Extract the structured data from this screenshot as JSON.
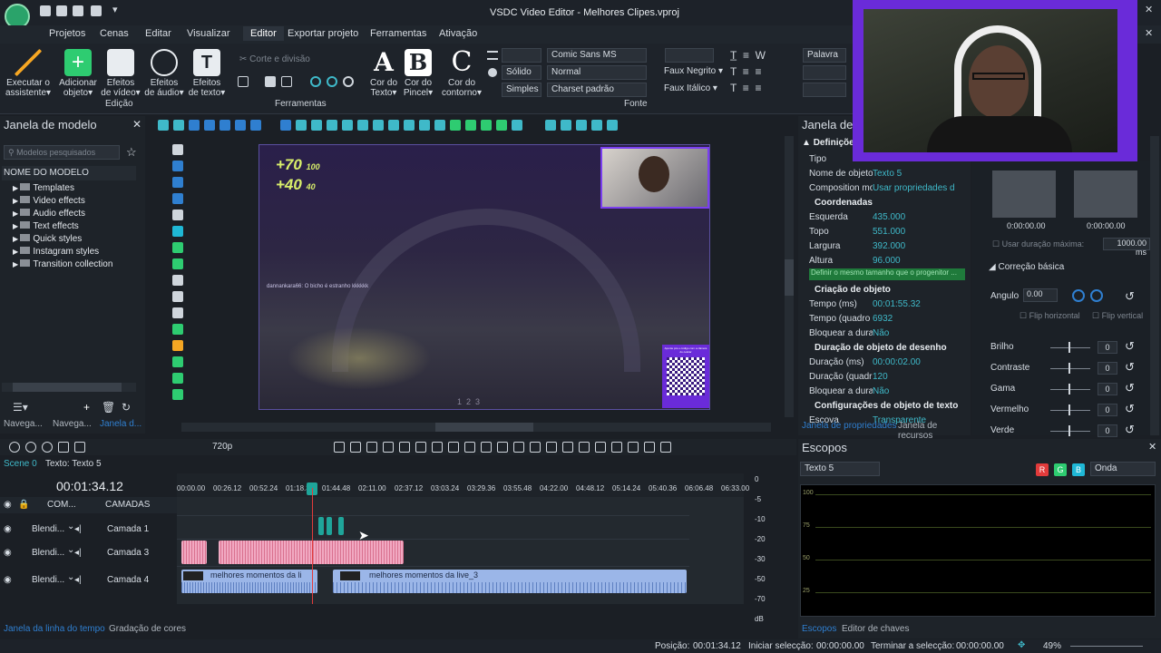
{
  "window": {
    "title": "VSDC Video Editor - Melhores Clipes.vproj"
  },
  "menu": [
    "Projetos",
    "Cenas",
    "Editar",
    "Visualizar",
    "Editor",
    "Exportar projeto",
    "Ferramentas",
    "Ativação"
  ],
  "menu_active_index": 4,
  "ribbon": {
    "buttons": [
      {
        "l1": "Executar o",
        "l2": "assistente▾"
      },
      {
        "l1": "Adicionar",
        "l2": "objeto▾"
      },
      {
        "l1": "Efeitos",
        "l2": "de vídeo▾"
      },
      {
        "l1": "Efeitos",
        "l2": "de áudio▾"
      },
      {
        "l1": "Efeitos",
        "l2": "de texto▾"
      }
    ],
    "group_edicao": "Edição",
    "cut_label": "Corte e divisão",
    "group_ferramentas": "Ferramentas",
    "font_buttons": [
      {
        "l1": "Cor do",
        "l2": "Texto▾"
      },
      {
        "l1": "Cor do",
        "l2": "Pincel▾"
      },
      {
        "l1": "Cor do",
        "l2": "contorno▾"
      }
    ],
    "solid": "Sólido",
    "simple": "Simples",
    "font_family": "Comic Sans MS",
    "font_style": "Normal",
    "charset": "Charset padrão",
    "faux_bold": "Faux Negrito",
    "faux_italic": "Faux Itálico",
    "group_fonte": "Fonte",
    "word_wrap": "Palavra"
  },
  "template_panel": {
    "title": "Janela de modelo",
    "search_placeholder": "Modelos pesquisados",
    "column": "NOME DO MODELO",
    "items": [
      "Templates",
      "Video effects",
      "Audio effects",
      "Text effects",
      "Quick styles",
      "Instagram styles",
      "Transition collection"
    ],
    "tabs": [
      "Navega...",
      "Navega...",
      "Janela d..."
    ]
  },
  "preview": {
    "hud1": "+70",
    "hud1_small": "100",
    "hud2": "+40",
    "hud2_small": "40",
    "chat": "dannankara66: O bicho é estranho kkkkkk",
    "pager": "1  2  3",
    "qr_caption": "Aponte pra o código com a câmera do celular"
  },
  "properties": {
    "title": "Janela de",
    "header": "Definições",
    "rows": [
      {
        "k": "Tipo",
        "v": ""
      },
      {
        "k": "Nome de objeto",
        "v": "Texto 5"
      },
      {
        "k": "Composition mod",
        "v": "Usar propriedades da"
      }
    ],
    "coords_title": "Coordenadas",
    "coords": [
      {
        "k": "Esquerda",
        "v": "435.000"
      },
      {
        "k": "Topo",
        "v": "551.000"
      },
      {
        "k": "Largura",
        "v": "392.000"
      },
      {
        "k": "Altura",
        "v": "96.000"
      }
    ],
    "parent_btn": "Definir o mesmo tamanho que o progenitor ...",
    "creation_title": "Criação de objeto",
    "creation": [
      {
        "k": "Tempo (ms)",
        "v": "00:01:55.32"
      },
      {
        "k": "Tempo (quadro",
        "v": "6932"
      },
      {
        "k": "Bloquear a dura",
        "v": "Não"
      }
    ],
    "duration_title": "Duração de objeto de desenho",
    "duration": [
      {
        "k": "Duração (ms)",
        "v": "00:00:02.00"
      },
      {
        "k": "Duração (quadr",
        "v": "120"
      },
      {
        "k": "Bloquear a dura",
        "v": "Não"
      }
    ],
    "text_cfg_title": "Configurações de objeto de texto",
    "text_cfg": [
      {
        "k": "Escova",
        "v": "Transparente"
      }
    ],
    "tabs": [
      "Janela de propriedades",
      "Janela de recursos"
    ]
  },
  "basic_correction": {
    "t1": "0:00:00.00",
    "t2": "0:00:00.00",
    "max_duration_label": "Usar duração máxima:",
    "max_duration_value": "1000.00 ms",
    "title": "Correção básica",
    "angle_label": "Angulo",
    "angle_value": "0.00",
    "flip_h": "Flip horizontal",
    "flip_v": "Flip vertical",
    "sliders": [
      {
        "k": "Brilho",
        "v": "0"
      },
      {
        "k": "Contraste",
        "v": "0"
      },
      {
        "k": "Gama",
        "v": "0"
      },
      {
        "k": "Vermelho",
        "v": "0"
      },
      {
        "k": "Verde",
        "v": "0"
      }
    ]
  },
  "timeline": {
    "quality": "720p",
    "scene_tab": "Scene 0",
    "text_tab": "Texto: Texto 5",
    "timecode": "00:01:34.12",
    "ruler": [
      "00:00.00",
      "00:26.12",
      "00:52.24",
      "01:18.36",
      "01:44.48",
      "02:11.00",
      "02:37.12",
      "03:03.24",
      "03:29.36",
      "03:55.48",
      "04:22.00",
      "04:48.12",
      "05:14.24",
      "05:40.36",
      "06:06.48",
      "06:33.00"
    ],
    "header_row": {
      "mode": "COM...",
      "name": "CAMADAS"
    },
    "tracks": [
      {
        "mode": "Blendi...",
        "name": "Camada 1"
      },
      {
        "mode": "Blendi...",
        "name": "Camada 3"
      },
      {
        "mode": "Blendi...",
        "name": "Camada 4"
      }
    ],
    "clip_a": "melhores momentos da li",
    "clip_b": "melhores momentos da live_3",
    "db_scale": [
      "0",
      "-5",
      "-10",
      "-20",
      "-30",
      "-50",
      "-70",
      "dB"
    ],
    "tabs": [
      "Janela da linha do tempo",
      "Gradação de cores"
    ]
  },
  "scopes": {
    "title": "Escopos",
    "source": "Texto 5",
    "channels": [
      "R",
      "G",
      "B"
    ],
    "mode": "Onda",
    "grid": [
      "100",
      "75",
      "50",
      "25"
    ],
    "tabs": [
      "Escopos",
      "Editor de chaves"
    ]
  },
  "status": {
    "pos_label": "Posição:",
    "pos": "00:01:34.12",
    "sel_start_label": "Iniciar selecção:",
    "sel_start": "00:00:00.00",
    "sel_end_label": "Terminar a selecção:",
    "sel_end": "00:00:00.00",
    "zoom": "49%"
  },
  "colors": {
    "accent": "#2f7fd0",
    "teal": "#3fb9c9",
    "purple": "#6a2bd9",
    "clip_pink": "#f1a9c2",
    "clip_blue": "#9bb6e8",
    "green": "#2ecc71"
  }
}
